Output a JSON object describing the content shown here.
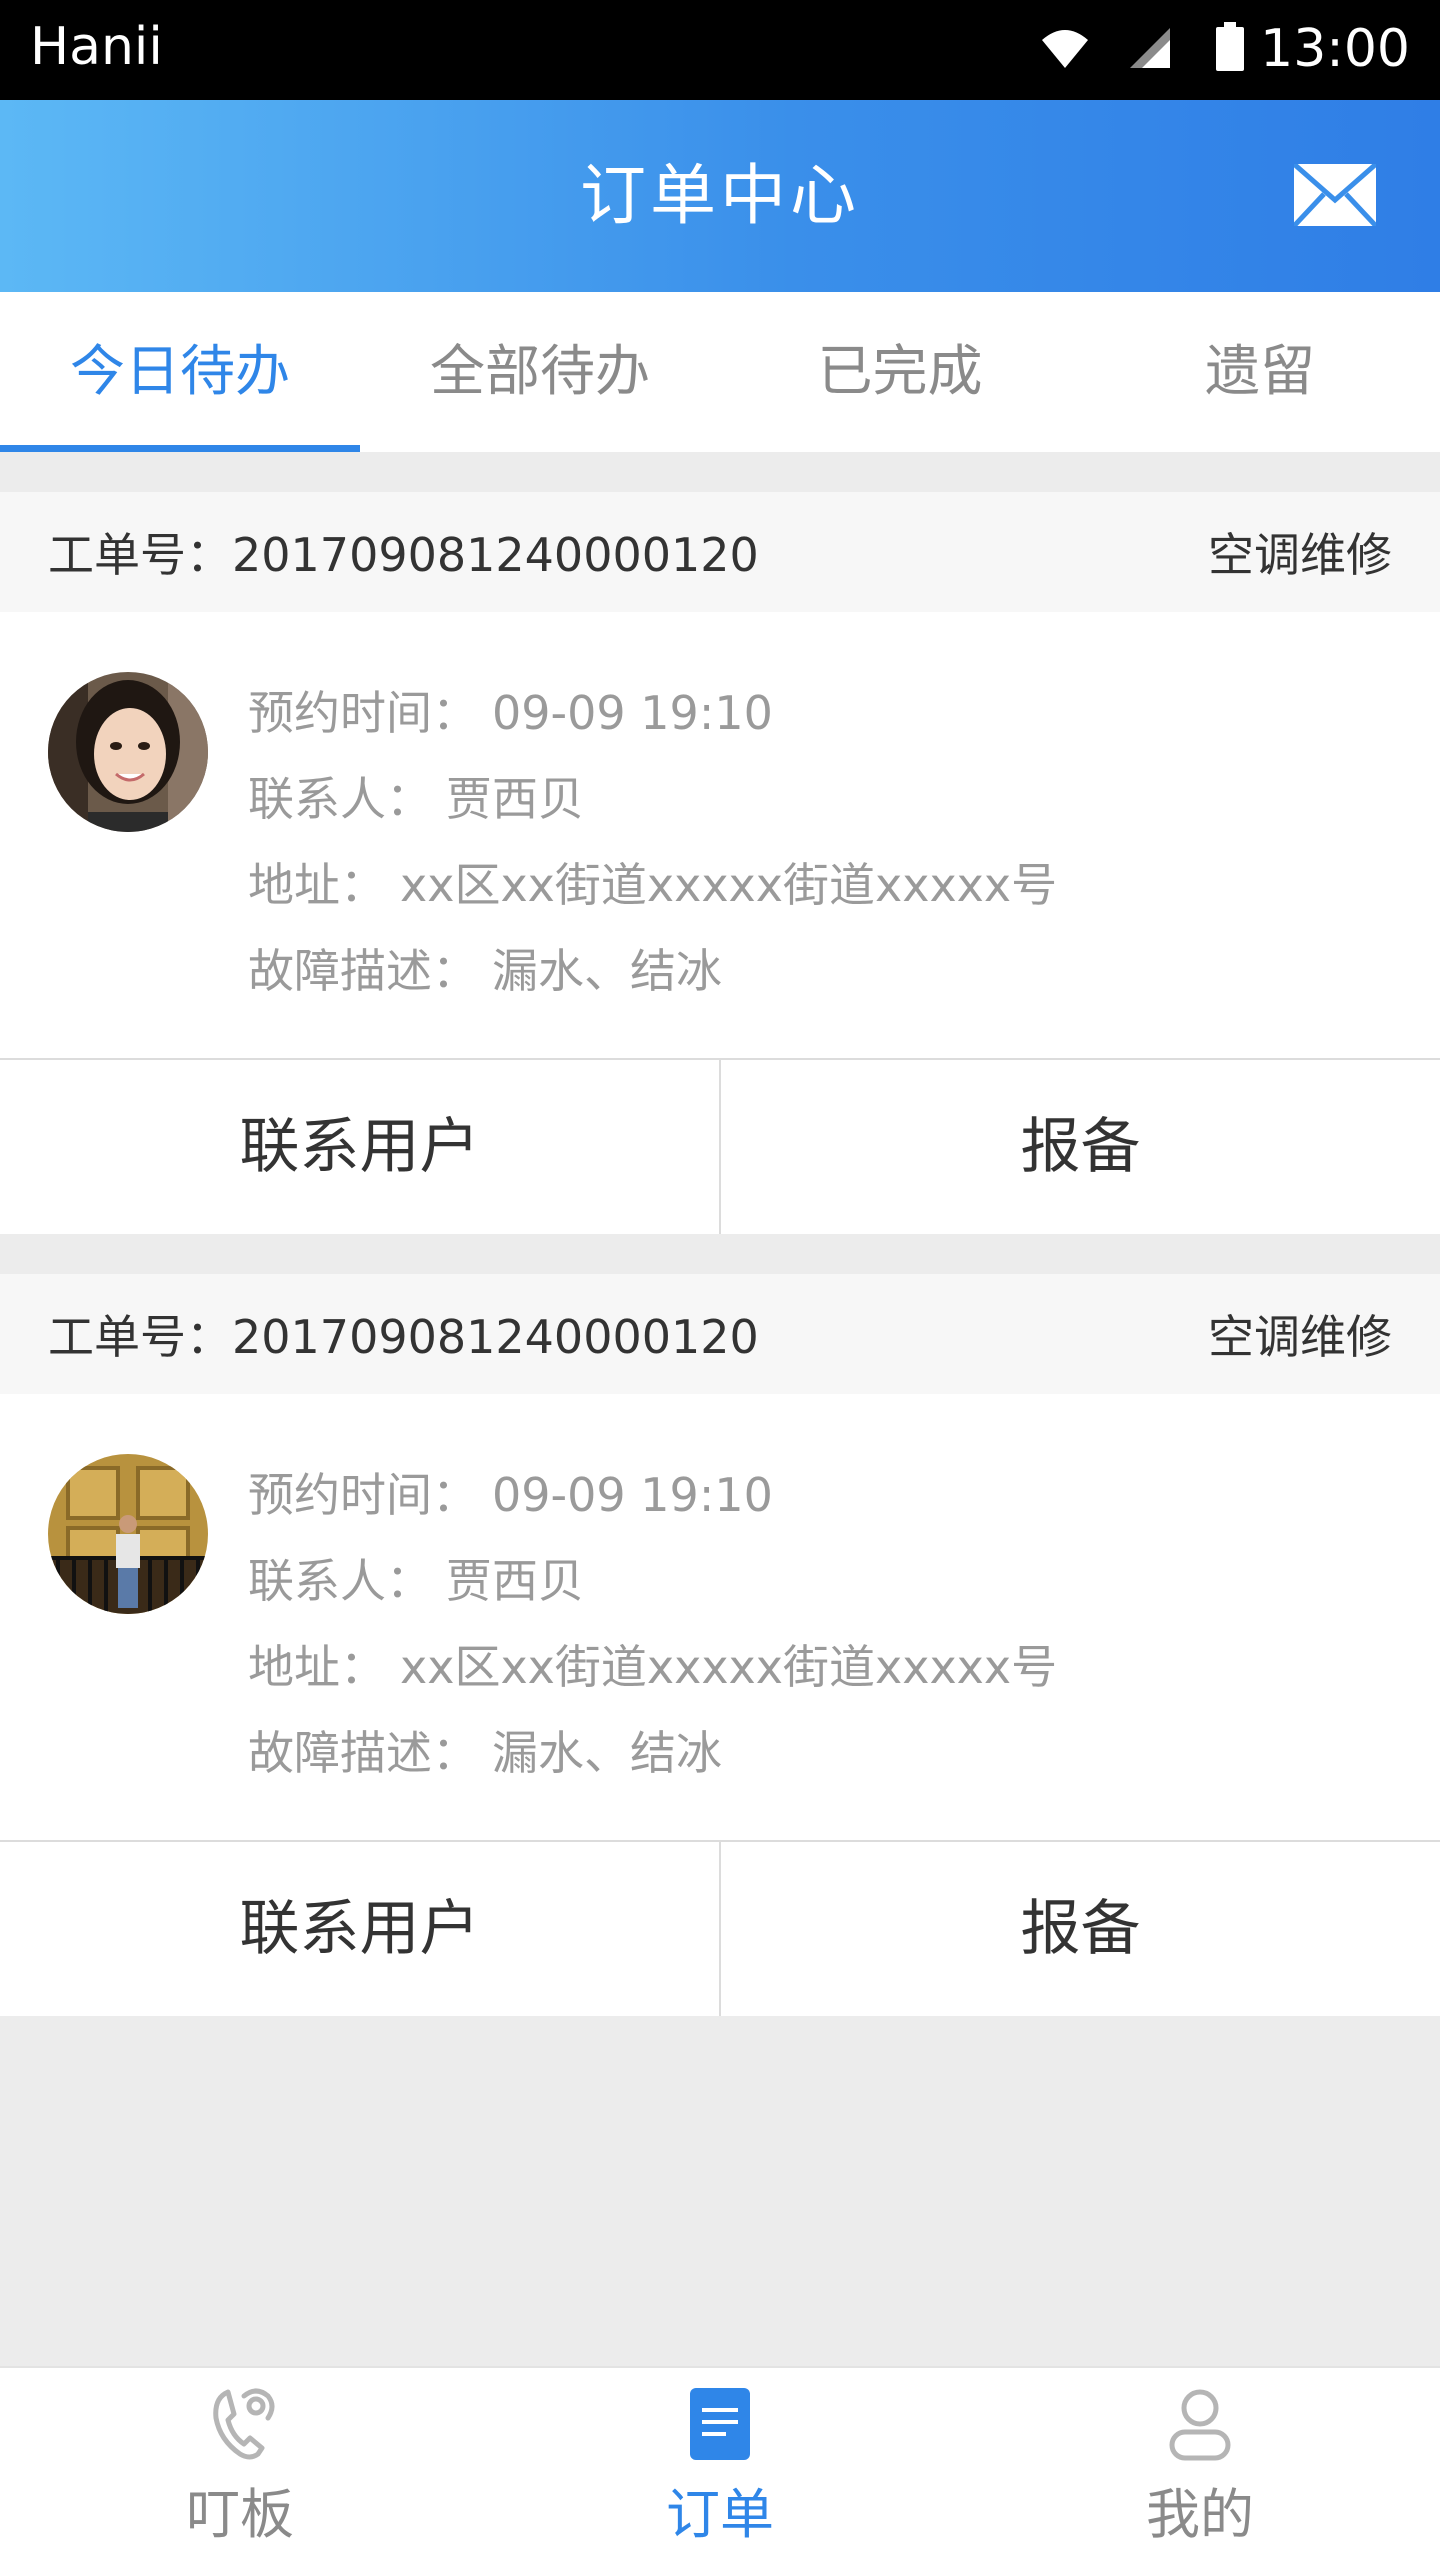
{
  "status_bar": {
    "carrier": "Hanii",
    "time": "13:00",
    "icons": [
      "wifi-icon",
      "signal-icon",
      "battery-icon"
    ]
  },
  "header": {
    "title": "订单中心",
    "icon": "mail-icon"
  },
  "tabs": [
    {
      "label": "今日待办",
      "active": true
    },
    {
      "label": "全部待办",
      "active": false
    },
    {
      "label": "已完成",
      "active": false
    },
    {
      "label": "遗留",
      "active": false
    }
  ],
  "orders": [
    {
      "order_label": "工单号：",
      "order_no": "201709081240000120",
      "service_type": "空调维修",
      "appointment_label": "预约时间：",
      "appointment_time": "09-09 19:10",
      "contact_label": "联系人：",
      "contact_name": "贾西贝",
      "address_label": "地址：",
      "address": "xx区xx街道xxxxx街道xxxxx号",
      "fault_label": "故障描述：",
      "fault": "漏水、结冰",
      "contact_button": "联系用户",
      "report_button": "报备"
    },
    {
      "order_label": "工单号：",
      "order_no": "201709081240000120",
      "service_type": "空调维修",
      "appointment_label": "预约时间：",
      "appointment_time": "09-09 19:10",
      "contact_label": "联系人：",
      "contact_name": "贾西贝",
      "address_label": "地址：",
      "address": "xx区xx街道xxxxx街道xxxxx号",
      "fault_label": "故障描述：",
      "fault": "漏水、结冰",
      "contact_button": "联系用户",
      "report_button": "报备"
    }
  ],
  "bottom_nav": [
    {
      "label": "叮板",
      "icon": "phone-ring-icon",
      "active": false
    },
    {
      "label": "订单",
      "icon": "document-icon",
      "active": true
    },
    {
      "label": "我的",
      "icon": "user-icon",
      "active": false
    }
  ],
  "colors": {
    "accent": "#2f86e8",
    "header_start": "#5cb8f5",
    "header_end": "#2f7ee6",
    "background": "#ececec"
  }
}
